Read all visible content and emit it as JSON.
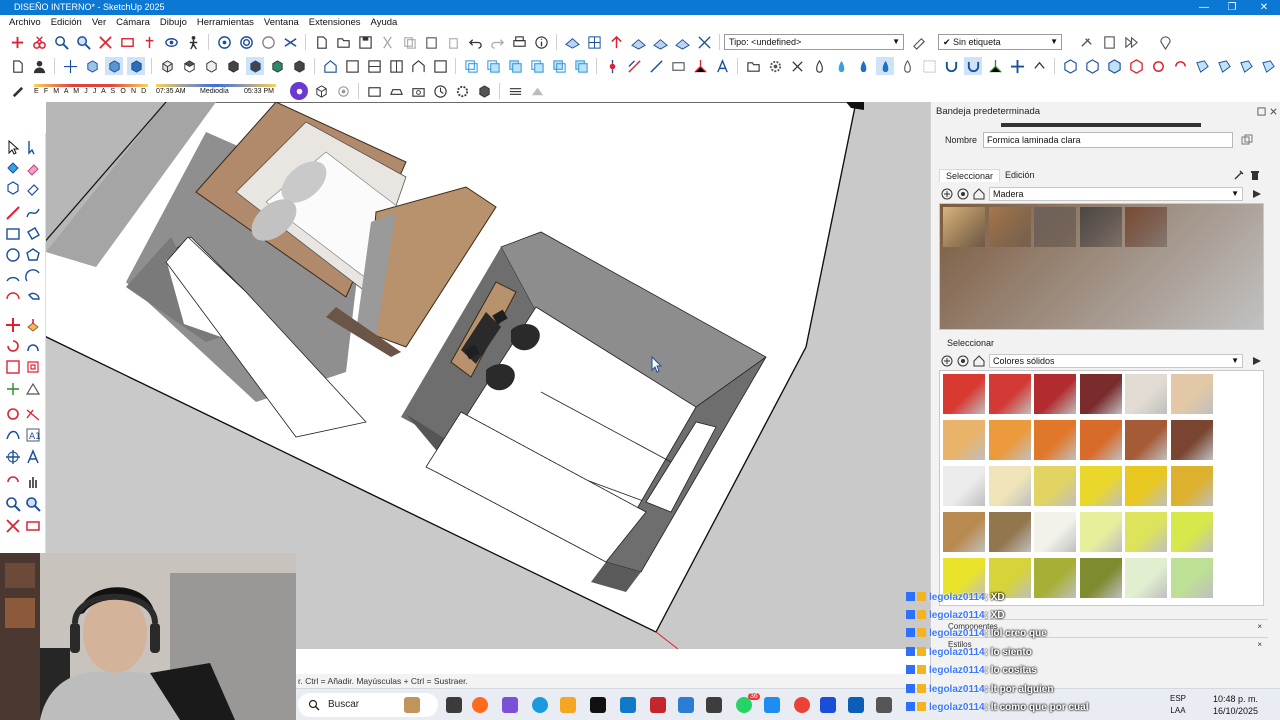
{
  "window": {
    "title": "DISEÑO INTERNO* - SketchUp 2025",
    "min": "—",
    "restore": "❐",
    "close": "✕"
  },
  "menu": [
    "Archivo",
    "Edición",
    "Ver",
    "Cámara",
    "Dibujo",
    "Herramientas",
    "Ventana",
    "Extensiones",
    "Ayuda"
  ],
  "toolbar": {
    "tag_type": "Tipo: <undefined>",
    "tag_filter": "✔ Sin etiqueta",
    "shadow_months": "E F M A M J J A S O N D",
    "shadow_time_start": "07:35 AM",
    "shadow_time_mid": "Mediodía",
    "shadow_time_end": "05:33 PM"
  },
  "status": {
    "hint": "r. Ctrl = Añadir. Mayúsculas + Ctrl = Sustraer."
  },
  "tray": {
    "title": "Bandeja predeterminada",
    "name_label": "Nombre",
    "name_value": "Formica laminada clara",
    "tab_select": "Seleccionar",
    "tab_edit": "Edición",
    "library_1": "Madera",
    "section_2": "Seleccionar",
    "library_2": "Colores sólidos",
    "components_label": "Componentes",
    "styles_label": "Estilos",
    "collapse_x": "×",
    "wood_swatches": [
      "#7b5a3f",
      "#d9b57c",
      "#a5784c",
      "#6f625c",
      "#4a4747",
      "#7b4a36"
    ],
    "color_swatches": [
      [
        "#d83a32",
        "#d33a35",
        "#b22c2f",
        "#7a2b2b",
        "#e1dbd2",
        "#e3c8a8"
      ],
      [
        "#e9b36a",
        "#ec9a3c",
        "#e07829",
        "#d86a2a",
        "#a55b36",
        "#7a4632"
      ],
      [
        "#ececec",
        "#efe5b8",
        "#e1d463",
        "#e9d72c",
        "#e8c820",
        "#ddb02d"
      ],
      [
        "#b98a4f",
        "#92764d",
        "#f2f2ea",
        "#e8ef9a",
        "#dde45c",
        "#d7e84a"
      ],
      [
        "#e9e42a",
        "#d6d33b",
        "#a7b036",
        "#808a2f",
        "#e2eed0",
        "#bddf96"
      ]
    ]
  },
  "chat": [
    {
      "user": "legolaz0114",
      "msg": ": XD"
    },
    {
      "user": "legolaz0114",
      "msg": ": XD"
    },
    {
      "user": "legolaz0114",
      "msg": ": lol creo que"
    },
    {
      "user": "legolaz0114",
      "msg": ": lo siento"
    },
    {
      "user": "legolaz0114",
      "msg": ": lo cositas"
    },
    {
      "user": "legolaz0114",
      "msg": ": lt por alguien"
    },
    {
      "user": "legolaz0114",
      "msg": ": lt como que por cual"
    }
  ],
  "taskbar": {
    "search": "Buscar",
    "lang_top": "ESP",
    "lang_bottom": "LAA",
    "time": "10:48 p. m.",
    "date": "16/10/2025",
    "badge": "36"
  }
}
